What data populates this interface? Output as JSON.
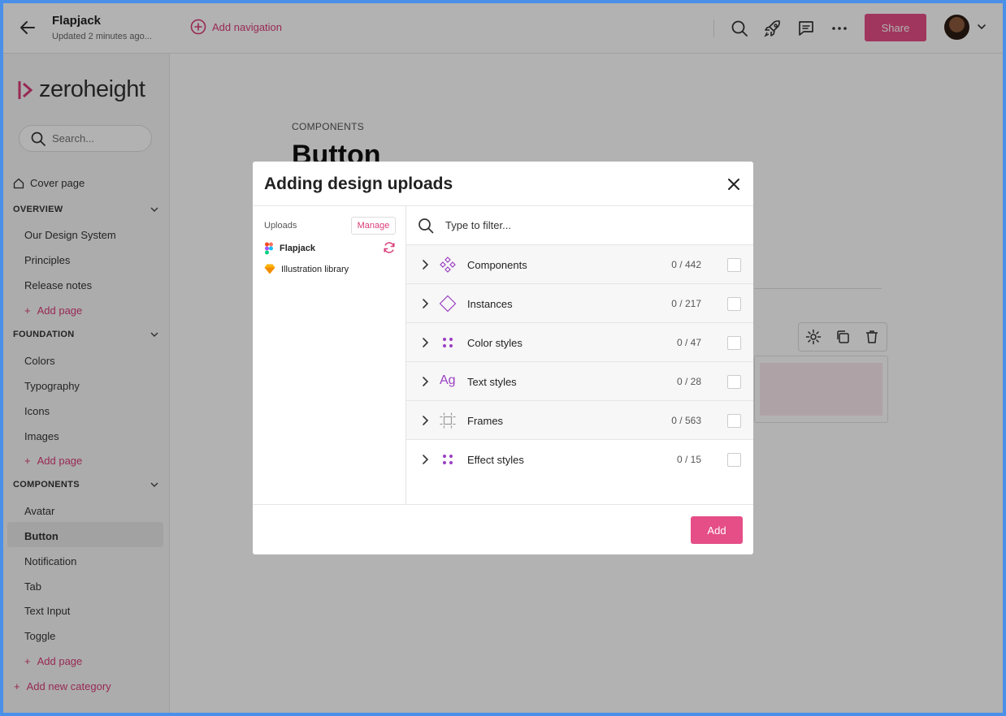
{
  "header": {
    "title": "Flapjack",
    "subtitle": "Updated 2 minutes ago...",
    "add_navigation": "Add navigation",
    "share": "Share"
  },
  "sidebar": {
    "brand": "zeroheight",
    "search_placeholder": "Search...",
    "cover": "Cover page",
    "sections": [
      {
        "title": "OVERVIEW",
        "items": [
          "Our Design System",
          "Principles",
          "Release notes"
        ],
        "add": "Add page"
      },
      {
        "title": "FOUNDATION",
        "items": [
          "Colors",
          "Typography",
          "Icons",
          "Images"
        ],
        "add": "Add page"
      },
      {
        "title": "COMPONENTS",
        "items": [
          "Avatar",
          "Button",
          "Notification",
          "Tab",
          "Text Input",
          "Toggle"
        ],
        "add": "Add page"
      }
    ],
    "active_item": "Button",
    "add_category": "Add new category"
  },
  "main": {
    "label": "COMPONENTS",
    "title": "Button"
  },
  "modal": {
    "title": "Adding design uploads",
    "uploads_label": "Uploads",
    "manage": "Manage",
    "uploads": [
      {
        "name": "Flapjack",
        "icon": "figma-icon"
      },
      {
        "name": "Illustration library",
        "icon": "sketch-icon"
      }
    ],
    "filter_placeholder": "Type to filter...",
    "categories": [
      {
        "label": "Components",
        "count": "0 / 442",
        "icon": "components-icon"
      },
      {
        "label": "Instances",
        "count": "0 / 217",
        "icon": "instance-icon"
      },
      {
        "label": "Color styles",
        "count": "0 / 47",
        "icon": "styles-icon"
      },
      {
        "label": "Text styles",
        "count": "0 / 28",
        "icon": "text-style-icon",
        "glyph": "Ag"
      },
      {
        "label": "Frames",
        "count": "0 / 563",
        "icon": "frame-icon"
      },
      {
        "label": "Effect styles",
        "count": "0 / 15",
        "icon": "styles-icon"
      }
    ],
    "add": "Add"
  },
  "colors": {
    "accent": "#e54e86",
    "accent_text": "#d93c78",
    "icon_purple": "#9b3fc2",
    "sketch_yellow": "#f7b500"
  }
}
